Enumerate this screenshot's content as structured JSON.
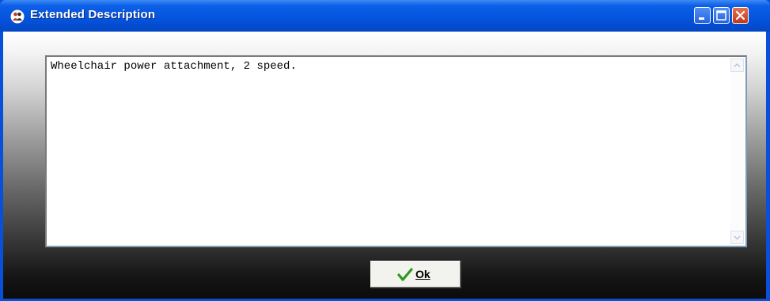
{
  "window": {
    "title": "Extended Description",
    "icon": "app-people-icon",
    "controls": [
      "minimize-icon",
      "maximize-icon",
      "close-icon"
    ]
  },
  "description": {
    "text": "Wheelchair power attachment, 2 speed."
  },
  "ok_button": {
    "label": "Ok",
    "icon": "checkmark-icon",
    "accent": "#2a9a1a"
  },
  "colors": {
    "titlebar": "#0453dd",
    "close": "#c8371a"
  }
}
